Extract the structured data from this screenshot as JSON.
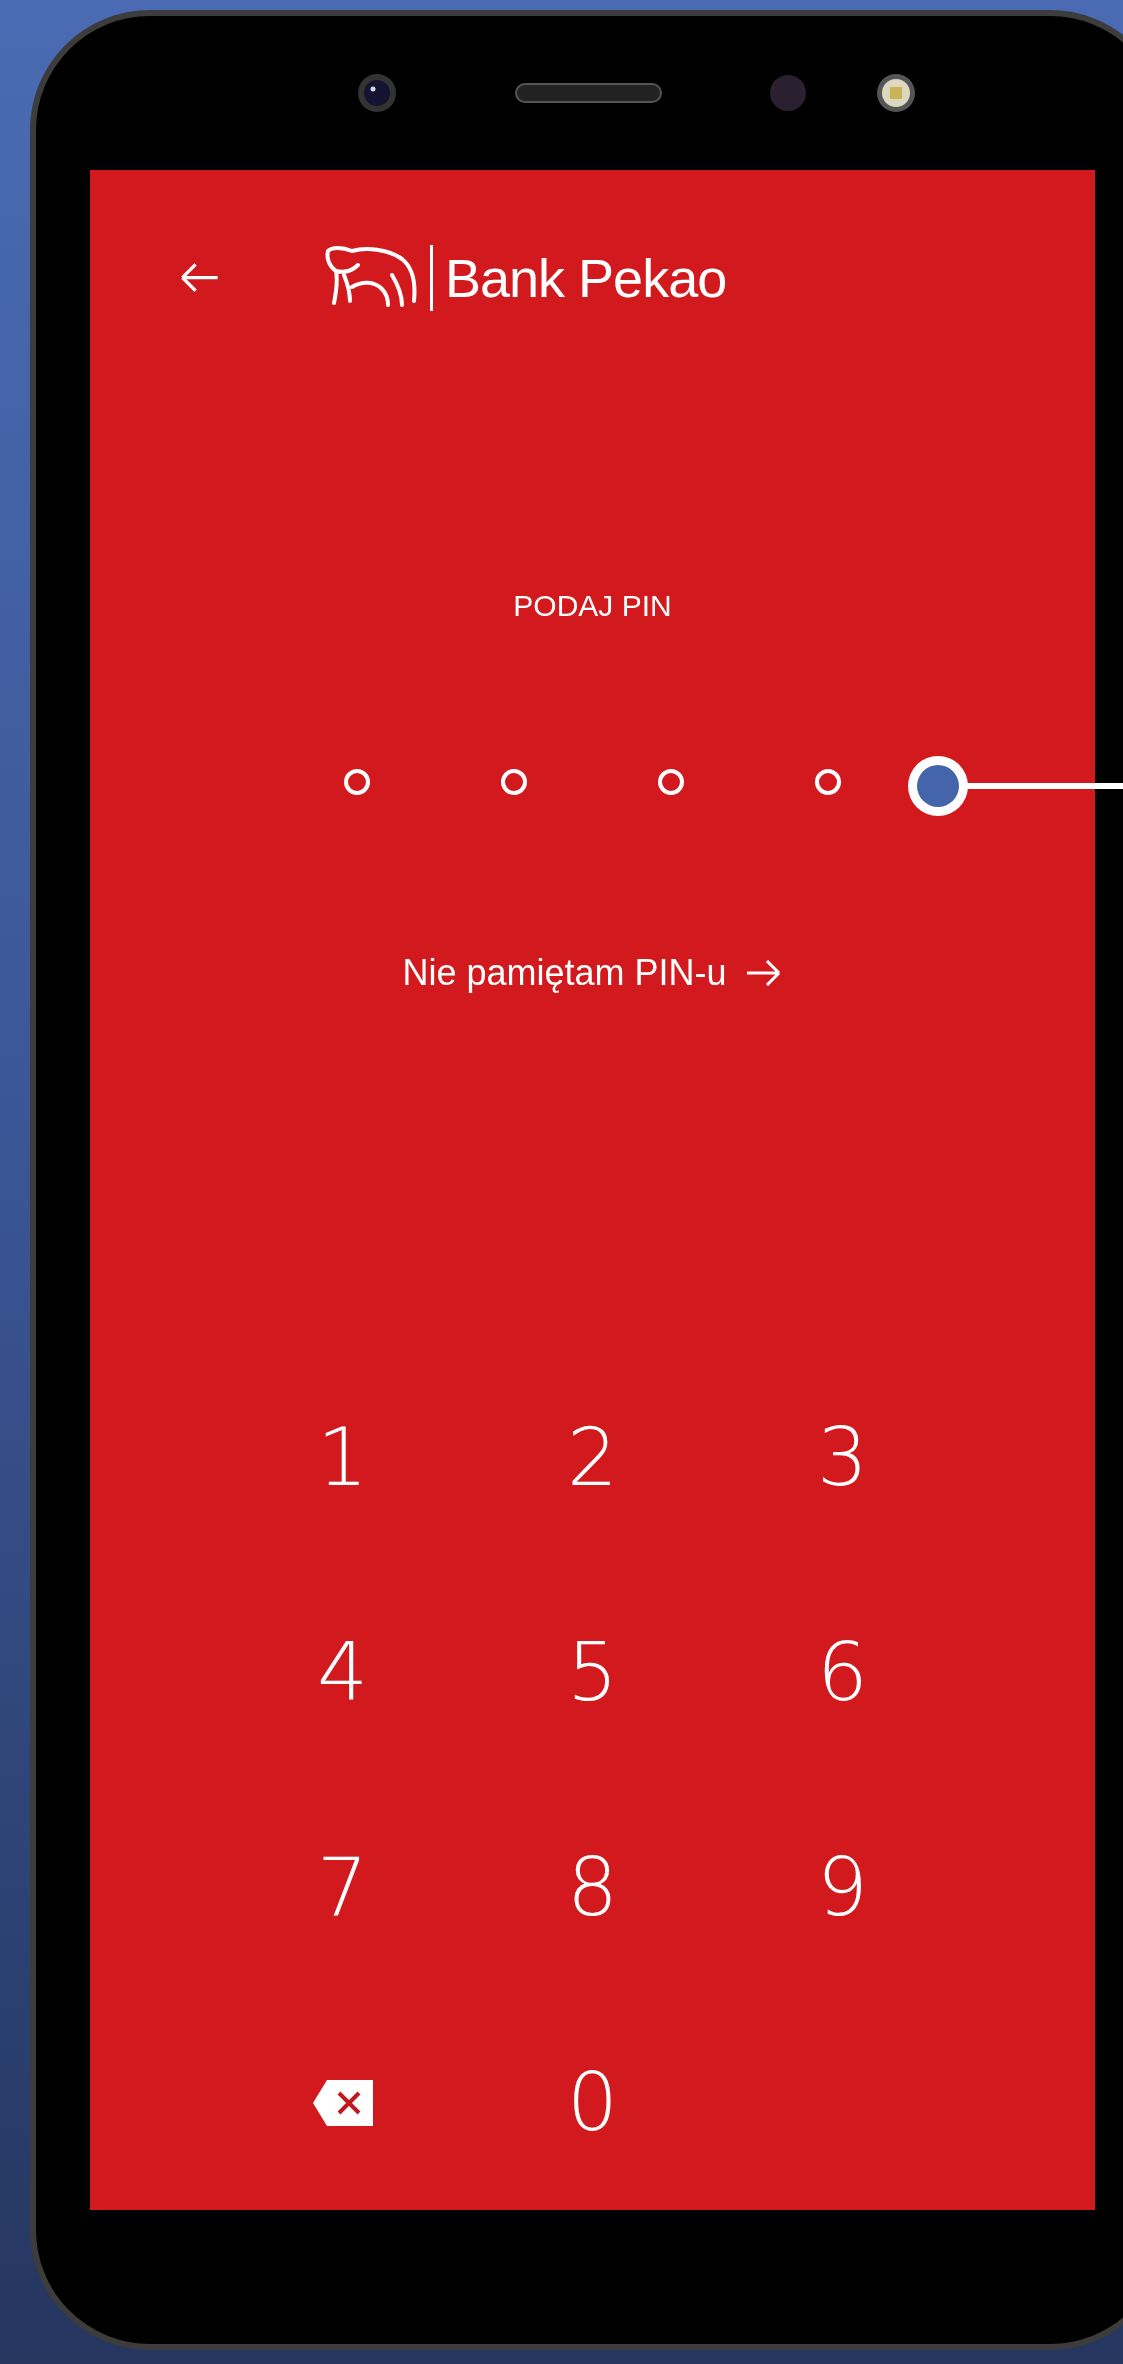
{
  "header": {
    "logo_text": "Bank Pekao"
  },
  "prompt": "PODAJ PIN",
  "pin_dots": [
    {
      "filled": false
    },
    {
      "filled": false
    },
    {
      "filled": false
    },
    {
      "filled": false
    }
  ],
  "forgot_link": "Nie pamiętam PIN-u",
  "keypad": [
    {
      "kind": "digit",
      "label": "1"
    },
    {
      "kind": "digit",
      "label": "2"
    },
    {
      "kind": "digit",
      "label": "3"
    },
    {
      "kind": "digit",
      "label": "4"
    },
    {
      "kind": "digit",
      "label": "5"
    },
    {
      "kind": "digit",
      "label": "6"
    },
    {
      "kind": "digit",
      "label": "7"
    },
    {
      "kind": "digit",
      "label": "8"
    },
    {
      "kind": "digit",
      "label": "9"
    },
    {
      "kind": "backspace"
    },
    {
      "kind": "digit",
      "label": "0"
    }
  ]
}
